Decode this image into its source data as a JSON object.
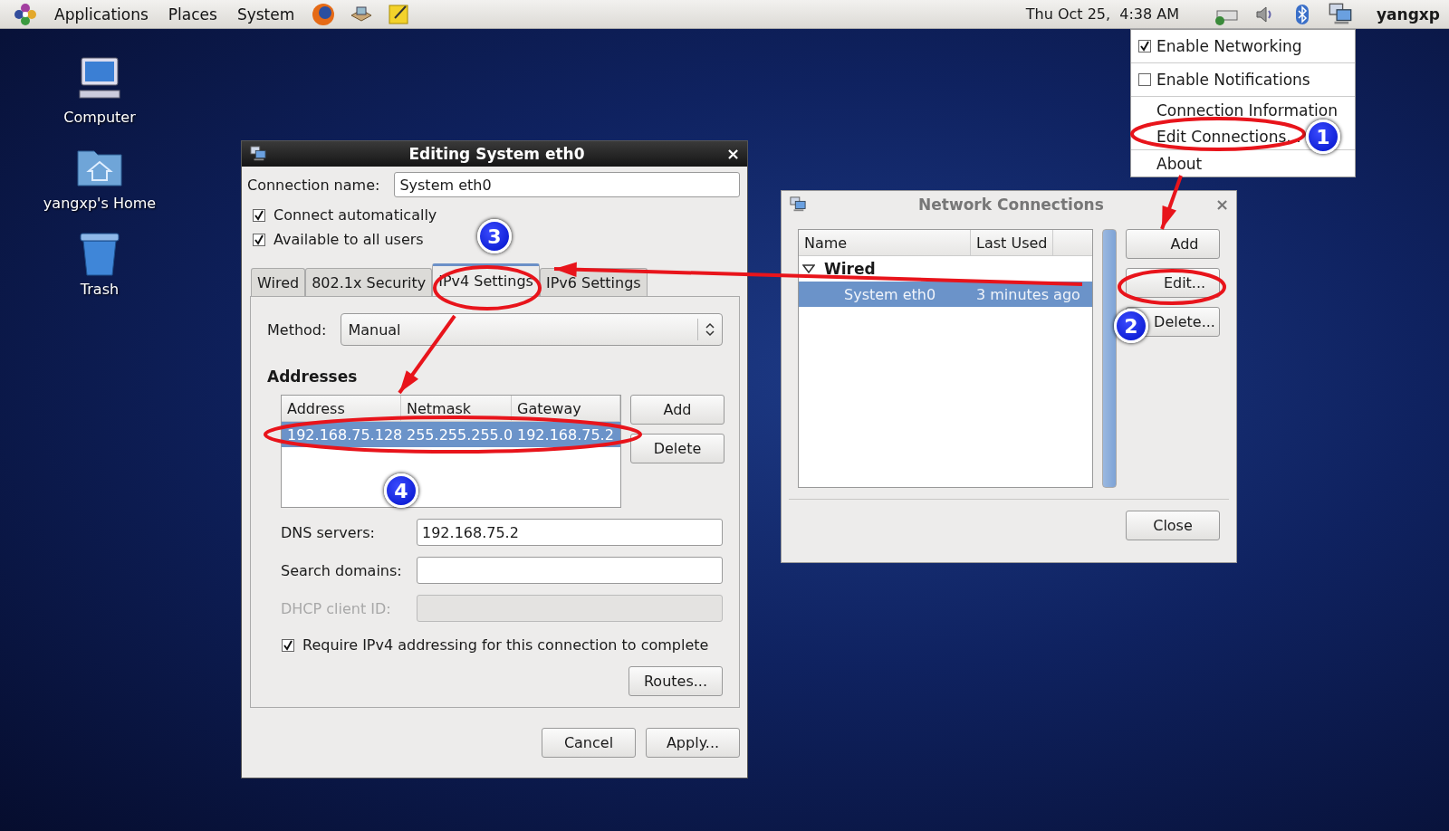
{
  "top_panel": {
    "menus": [
      "Applications",
      "Places",
      "System"
    ],
    "clock": "Thu Oct 25,  4:38 AM",
    "user": "yangxp"
  },
  "desktop_icons": [
    {
      "label": "Computer",
      "kind": "computer"
    },
    {
      "label": "yangxp's Home",
      "kind": "home"
    },
    {
      "label": "Trash",
      "kind": "trash"
    }
  ],
  "network_menu": {
    "items": [
      {
        "kind": "check",
        "label": "Enable Networking",
        "checked": true
      },
      {
        "kind": "separator"
      },
      {
        "kind": "check",
        "label": "Enable Notifications",
        "checked": false
      },
      {
        "kind": "separator"
      },
      {
        "kind": "item",
        "label": "Connection Information"
      },
      {
        "kind": "item",
        "label": "Edit Connections..."
      },
      {
        "kind": "separator"
      },
      {
        "kind": "item",
        "label": "About"
      }
    ]
  },
  "network_connections": {
    "title": "Network Connections",
    "close_label": "×",
    "columns": [
      "Name",
      "Last Used"
    ],
    "groups": [
      {
        "name": "Wired",
        "expanded": true,
        "children": [
          {
            "name": "System eth0",
            "last_used": "3 minutes ago",
            "selected": true
          }
        ]
      }
    ],
    "buttons": [
      "Add",
      "Edit...",
      "Delete..."
    ],
    "close_button": "Close"
  },
  "editor": {
    "title": "Editing System eth0",
    "close_label": "×",
    "connection_name_label": "Connection name:",
    "connection_name": "System eth0",
    "options": [
      {
        "label": "Connect automatically",
        "checked": true
      },
      {
        "label": "Available to all users",
        "checked": true
      }
    ],
    "tabs": [
      {
        "label": "Wired",
        "selected": false
      },
      {
        "label": "802.1x Security",
        "selected": false
      },
      {
        "label": "IPv4 Settings",
        "selected": true
      },
      {
        "label": "IPv6 Settings",
        "selected": false
      }
    ],
    "method_label": "Method:",
    "method": "Manual",
    "addresses_heading": "Addresses",
    "address_columns": [
      "Address",
      "Netmask",
      "Gateway"
    ],
    "address_rows": [
      {
        "cells": [
          "192.168.75.128",
          "255.255.255.0",
          "192.168.75.2"
        ],
        "selected": true
      }
    ],
    "address_buttons": [
      "Add",
      "Delete"
    ],
    "fields": [
      {
        "label": "DNS servers:",
        "value": "192.168.75.2",
        "disabled": false
      },
      {
        "label": "Search domains:",
        "disabled": false
      },
      {
        "label": "DHCP client ID:",
        "disabled": true
      }
    ],
    "require": {
      "label": "Require IPv4 addressing for this connection to complete",
      "checked": true
    },
    "routes_button": "Routes...",
    "buttons": [
      "Cancel",
      "Apply..."
    ]
  },
  "annotations": {
    "step_badges": [
      "1",
      "2",
      "3",
      "4"
    ]
  }
}
